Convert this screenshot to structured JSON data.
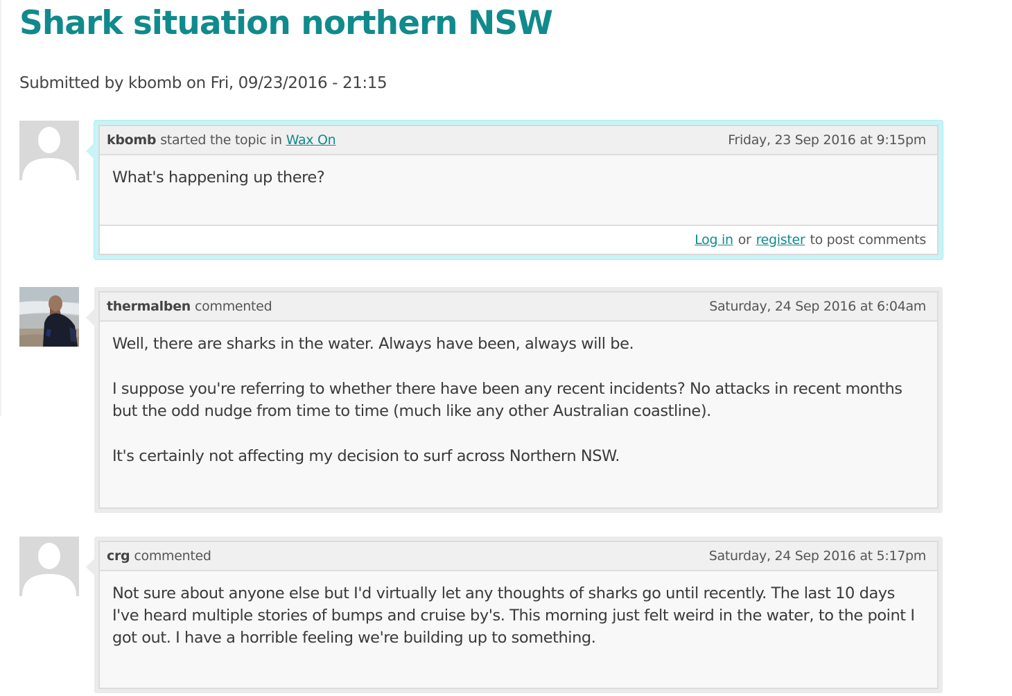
{
  "page": {
    "title": "Shark situation northern NSW",
    "submitted": "Submitted by kbomb on Fri, 09/23/2016 - 21:15"
  },
  "topic": {
    "author": "kbomb",
    "action": "started the topic in",
    "forum_link": "Wax On",
    "date": "Friday, 23 Sep 2016 at 9:15pm",
    "body": [
      "What's happening up there?"
    ],
    "footer": {
      "login": "Log in",
      "or": "or",
      "register": "register",
      "suffix": "to post comments"
    }
  },
  "comments": [
    {
      "author": "thermalben",
      "action": "commented",
      "date": "Saturday, 24 Sep 2016 at 6:04am",
      "body": [
        "Well, there are sharks in the water. Always have been, always will be.",
        "I suppose you're referring to whether there have been any recent incidents? No attacks in recent months but the odd nudge from time to time (much like any other Australian coastline).",
        "It's certainly not affecting my decision to surf across Northern NSW."
      ]
    },
    {
      "author": "crg",
      "action": "commented",
      "date": "Saturday, 24 Sep 2016 at 5:17pm",
      "body": [
        "Not sure about anyone else but I'd virtually let any thoughts of sharks go until recently. The last 10 days I've heard multiple stories of bumps and cruise by's. This morning just felt weird in the water, to the point I got out. I have a horrible feeling we're building up to something."
      ]
    }
  ],
  "colors": {
    "accent": "#108a8c",
    "topic_highlight": "#c8f4f6",
    "comment_frame": "#ebebeb"
  },
  "icons": {
    "default_avatar": "user-silhouette-icon",
    "photo_avatar": "surfer-photo"
  }
}
